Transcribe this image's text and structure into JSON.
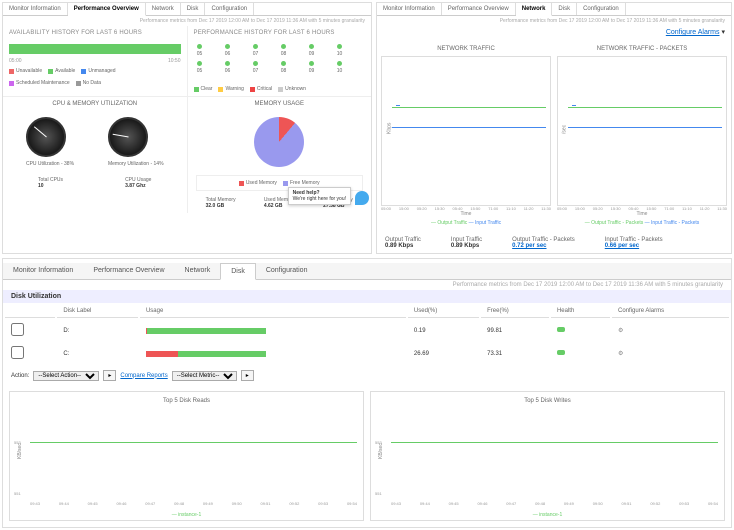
{
  "top_left": {
    "tabs": [
      "Monitor Information",
      "Performance Overview",
      "Network",
      "Disk",
      "Configuration"
    ],
    "active_tab": 1,
    "meta": "Performance metrics from Dec 17 2019 12:00 AM to Dec 17 2019 11:36 AM with 5 minutes granularity",
    "availability": {
      "title": "AVAILABILITY HISTORY FOR LAST 6 HOURS",
      "axis": [
        "05:00",
        "",
        "",
        "",
        "",
        "",
        "",
        "",
        "",
        "",
        "",
        "10:50"
      ],
      "legend": [
        {
          "color": "#e66",
          "label": "Unavailable"
        },
        {
          "color": "#6c6",
          "label": "Available"
        },
        {
          "color": "#48e",
          "label": "Unmanaged"
        },
        {
          "color": "#c6e",
          "label": "Scheduled Maintenance"
        },
        {
          "color": "#999",
          "label": "No Data"
        }
      ]
    },
    "perf_history": {
      "title": "PERFORMANCE HISTORY FOR LAST 6 HOURS",
      "hours_top": [
        "05",
        "06",
        "07",
        "08",
        "09",
        "10"
      ],
      "hours_bot": [
        "05",
        "06",
        "07",
        "08",
        "09",
        "10"
      ],
      "legend": [
        {
          "color": "#6c6",
          "label": "Clear"
        },
        {
          "color": "#fc4",
          "label": "Warning"
        },
        {
          "color": "#e44",
          "label": "Critical"
        },
        {
          "color": "#ccc",
          "label": "Unknown"
        }
      ]
    },
    "cpu_mem": {
      "title": "CPU & MEMORY UTILIZATION",
      "cpu_label": "CPU Utilization - 38%",
      "mem_label": "Memory Utilization - 14%",
      "cpu_needle_deg": -50,
      "mem_needle_deg": -80,
      "total_cpus_lbl": "Total CPUs",
      "total_cpus": "10",
      "cpu_usage_lbl": "CPU Usage",
      "cpu_usage": "3.87 Ghz"
    },
    "memory_usage": {
      "title": "MEMORY USAGE",
      "legend": [
        {
          "color": "#e55",
          "label": "Used Memory"
        },
        {
          "color": "#99e",
          "label": "Free Memory"
        }
      ],
      "stats": [
        {
          "k": "Total Memory",
          "v": "32.0 GB"
        },
        {
          "k": "Used Memory",
          "v": "4.62 GB"
        },
        {
          "k": "Free Memory",
          "v": "27.38 GB"
        }
      ],
      "tooltip_title": "Need help?",
      "tooltip_body": "We're right here for you!"
    }
  },
  "top_right": {
    "tabs": [
      "Monitor Information",
      "Performance Overview",
      "Network",
      "Disk",
      "Configuration"
    ],
    "active_tab": 2,
    "meta": "Performance metrics from Dec 17 2019 12:00 AM to Dec 17 2019 11:36 AM with 5 minutes granularity",
    "configure_alarms": "Configure Alarms",
    "charts": [
      {
        "title": "NETWORK TRAFFIC",
        "ylab": "Kbps",
        "xlab": "Time",
        "legend": [
          "Output Traffic",
          "Input Traffic"
        ],
        "colors": [
          "#6c6",
          "#48e"
        ],
        "xticks": [
          "05:00",
          "15:00",
          "05:20",
          "15:30",
          "05:40",
          "15:50",
          "71:00",
          "11:10",
          "11:20",
          "11:30"
        ]
      },
      {
        "title": "NETWORK TRAFFIC - PACKETS",
        "ylab": "/sec",
        "xlab": "Time",
        "legend": [
          "Output Traffic - Packets",
          "Input Traffic - Packets"
        ],
        "colors": [
          "#6c6",
          "#48e"
        ],
        "xticks": [
          "05:00",
          "15:00",
          "05:20",
          "15:30",
          "05:40",
          "15:50",
          "71:00",
          "11:10",
          "11:20",
          "11:30"
        ]
      }
    ],
    "footer": [
      {
        "k": "Output Traffic",
        "v": "0.89 Kbps",
        "link": false
      },
      {
        "k": "Input Traffic",
        "v": "0.89 Kbps",
        "link": false
      },
      {
        "k": "Output Traffic - Packets",
        "v": "0.72 per sec",
        "link": true
      },
      {
        "k": "Input Traffic - Packets",
        "v": "0.66 per sec",
        "link": true
      }
    ]
  },
  "disk": {
    "tabs": [
      "Monitor Information",
      "Performance Overview",
      "Network",
      "Disk",
      "Configuration"
    ],
    "active_tab": 3,
    "meta": "Performance metrics from Dec 17 2019 12:00 AM to Dec 17 2019 11:36 AM with 5 minutes granularity",
    "section": "Disk Utilization",
    "columns": [
      "",
      "Disk Label",
      "Usage",
      "Used(%)",
      "Free(%)",
      "Health",
      "Configure Alarms"
    ],
    "rows": [
      {
        "label": "D:",
        "used": 0.19,
        "free": 99.81,
        "fill1": 1,
        "fill1c": "#e55",
        "fill2": 99,
        "fill2c": "#6c6"
      },
      {
        "label": "C:",
        "used": 26.69,
        "free": 73.31,
        "fill1": 27,
        "fill1c": "#e55",
        "fill2": 73,
        "fill2c": "#6c6"
      }
    ],
    "action_lbl": "Action:",
    "select_action": "--Select Action--",
    "compare_reports": "Compare Reports",
    "select_metric": "--Select Metric--",
    "charts": [
      {
        "title": "Top 5 Disk Reads",
        "ylab": "KB/sec",
        "legend": "instance-1",
        "xticks": [
          "09:43",
          "09:44",
          "09:45",
          "09:46",
          "09:47",
          "09:48",
          "09:49",
          "09:50",
          "09:51",
          "09:52",
          "09:53",
          "09:54"
        ]
      },
      {
        "title": "Top 5 Disk Writes",
        "ylab": "KB/sec",
        "legend": "instance-1",
        "xticks": [
          "09:43",
          "09:44",
          "09:45",
          "09:46",
          "09:47",
          "09:48",
          "09:49",
          "09:50",
          "09:51",
          "09:52",
          "09:53",
          "09:54"
        ]
      }
    ]
  },
  "chart_data": [
    {
      "type": "pie",
      "title": "Memory Usage",
      "series": [
        {
          "name": "Used Memory",
          "value": 4.62
        },
        {
          "name": "Free Memory",
          "value": 27.38
        }
      ]
    },
    {
      "type": "line",
      "title": "Network Traffic",
      "ylabel": "Kbps",
      "xlabel": "Time",
      "x": [
        "05:00",
        "05:10",
        "05:20",
        "05:30",
        "05:40",
        "05:50",
        "11:00",
        "11:10",
        "11:20",
        "11:30"
      ],
      "series": [
        {
          "name": "Output Traffic",
          "values": [
            0.9,
            0.9,
            0.9,
            0.9,
            0.9,
            0.9,
            0.9,
            0.9,
            0.9,
            0.9
          ]
        },
        {
          "name": "Input Traffic",
          "values": [
            0.7,
            1.6,
            0.7,
            0.7,
            0.7,
            0.7,
            0.7,
            0.7,
            0.7,
            0.7
          ]
        }
      ]
    },
    {
      "type": "line",
      "title": "Network Traffic - Packets",
      "ylabel": "/sec",
      "xlabel": "Time",
      "x": [
        "05:00",
        "05:10",
        "05:20",
        "05:30",
        "05:40",
        "05:50",
        "11:00",
        "11:10",
        "11:20",
        "11:30"
      ],
      "series": [
        {
          "name": "Output Traffic - Packets",
          "values": [
            0.72,
            0.72,
            0.72,
            0.72,
            0.72,
            0.72,
            0.72,
            0.72,
            0.72,
            0.72
          ]
        },
        {
          "name": "Input Traffic - Packets",
          "values": [
            0.66,
            0.66,
            0.66,
            0.66,
            0.66,
            0.66,
            0.66,
            0.66,
            0.66,
            0.66
          ]
        }
      ]
    },
    {
      "type": "line",
      "title": "Top 5 Disk Reads",
      "ylabel": "KB/sec",
      "x": [
        "09:43",
        "09:44",
        "09:45",
        "09:46",
        "09:47",
        "09:48",
        "09:49",
        "09:50",
        "09:51",
        "09:52",
        "09:53",
        "09:54"
      ],
      "series": [
        {
          "name": "instance-1",
          "values": [
            553,
            553,
            553,
            553,
            553,
            553,
            553,
            553,
            553,
            553,
            553,
            553
          ]
        }
      ]
    },
    {
      "type": "line",
      "title": "Top 5 Disk Writes",
      "ylabel": "KB/sec",
      "x": [
        "09:43",
        "09:44",
        "09:45",
        "09:46",
        "09:47",
        "09:48",
        "09:49",
        "09:50",
        "09:51",
        "09:52",
        "09:53",
        "09:54"
      ],
      "series": [
        {
          "name": "instance-1",
          "values": [
            551,
            551,
            551,
            551,
            551,
            551,
            551,
            551,
            551,
            551,
            551,
            551
          ]
        }
      ]
    }
  ]
}
